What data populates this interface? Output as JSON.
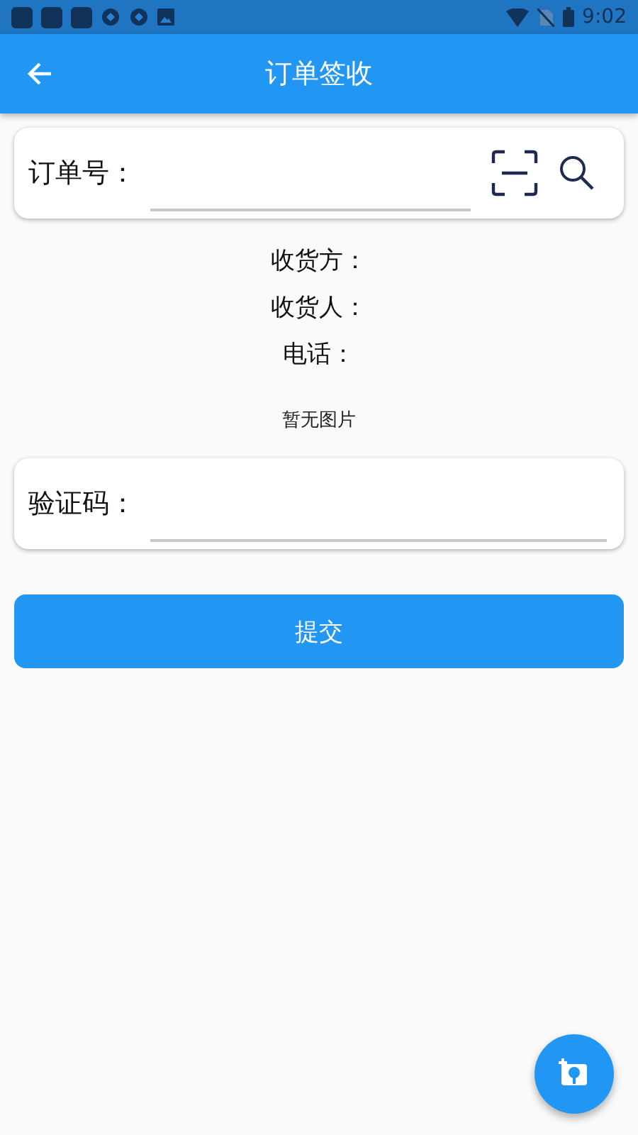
{
  "status_bar": {
    "time": "9:02"
  },
  "app_bar": {
    "title": "订单签收"
  },
  "order_field": {
    "label": "订单号："
  },
  "info": [
    {
      "label": "收货方："
    },
    {
      "label": "收货人："
    },
    {
      "label": "电话："
    }
  ],
  "photo": {
    "empty_text": "暂无图片"
  },
  "code_field": {
    "label": "验证码："
  },
  "submit": {
    "label": "提交"
  }
}
